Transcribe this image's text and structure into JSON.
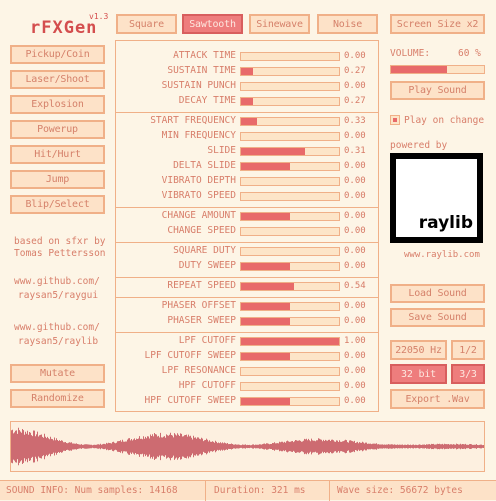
{
  "app": {
    "title": "rFXGen",
    "version": "v1.3"
  },
  "wave_tabs": [
    {
      "label": "Square",
      "active": false
    },
    {
      "label": "Sawtooth",
      "active": true
    },
    {
      "label": "Sinewave",
      "active": false
    },
    {
      "label": "Noise",
      "active": false
    }
  ],
  "screen_size_label": "Screen Size x2",
  "presets": [
    "Pickup/Coin",
    "Laser/Shoot",
    "Explosion",
    "Powerup",
    "Hit/Hurt",
    "Jump",
    "Blip/Select"
  ],
  "credits": {
    "line1": "based on sfxr by",
    "line2": "Tomas Pettersson",
    "repo1a": "www.github.com/",
    "repo1b": "raysan5/raygui",
    "repo2a": "www.github.com/",
    "repo2b": "raysan5/raylib"
  },
  "mutate_label": "Mutate",
  "randomize_label": "Randomize",
  "groups": [
    {
      "params": [
        {
          "label": "ATTACK TIME",
          "value": "0.00",
          "fill": 0.0
        },
        {
          "label": "SUSTAIN TIME",
          "value": "0.27",
          "fill": 0.12
        },
        {
          "label": "SUSTAIN PUNCH",
          "value": "0.00",
          "fill": 0.0
        },
        {
          "label": "DECAY TIME",
          "value": "0.27",
          "fill": 0.12
        }
      ]
    },
    {
      "params": [
        {
          "label": "START FREQUENCY",
          "value": "0.33",
          "fill": 0.16
        },
        {
          "label": "MIN FREQUENCY",
          "value": "0.00",
          "fill": 0.0
        },
        {
          "label": "SLIDE",
          "value": "0.31",
          "fill": 0.65
        },
        {
          "label": "DELTA SLIDE",
          "value": "0.00",
          "fill": 0.5
        },
        {
          "label": "VIBRATO DEPTH",
          "value": "0.00",
          "fill": 0.0
        },
        {
          "label": "VIBRATO SPEED",
          "value": "0.00",
          "fill": 0.0
        }
      ]
    },
    {
      "params": [
        {
          "label": "CHANGE AMOUNT",
          "value": "0.00",
          "fill": 0.5
        },
        {
          "label": "CHANGE SPEED",
          "value": "0.00",
          "fill": 0.0
        }
      ]
    },
    {
      "params": [
        {
          "label": "SQUARE DUTY",
          "value": "0.00",
          "fill": 0.0
        },
        {
          "label": "DUTY SWEEP",
          "value": "0.00",
          "fill": 0.5
        }
      ]
    },
    {
      "params": [
        {
          "label": "REPEAT SPEED",
          "value": "0.54",
          "fill": 0.54
        }
      ]
    },
    {
      "params": [
        {
          "label": "PHASER OFFSET",
          "value": "0.00",
          "fill": 0.5
        },
        {
          "label": "PHASER SWEEP",
          "value": "0.00",
          "fill": 0.5
        }
      ]
    },
    {
      "params": [
        {
          "label": "LPF CUTOFF",
          "value": "1.00",
          "fill": 1.0
        },
        {
          "label": "LPF CUTOFF SWEEP",
          "value": "0.00",
          "fill": 0.5
        },
        {
          "label": "LPF RESONANCE",
          "value": "0.00",
          "fill": 0.0
        },
        {
          "label": "HPF CUTOFF",
          "value": "0.00",
          "fill": 0.0
        },
        {
          "label": "HPF CUTOFF SWEEP",
          "value": "0.00",
          "fill": 0.5
        }
      ]
    }
  ],
  "volume": {
    "label": "VOLUME:",
    "value_text": "60 %",
    "fill": 0.6
  },
  "play_sound_label": "Play Sound",
  "play_on_change": {
    "label": "Play on change",
    "checked": true
  },
  "powered_by": "powered by",
  "raylib_logo_text": "raylib",
  "raylib_url": "www.raylib.com",
  "load_sound_label": "Load Sound",
  "save_sound_label": "Save Sound",
  "sample_rate": {
    "options": [
      "22050 Hz",
      "1/2"
    ]
  },
  "bit_depth": {
    "options": [
      "32 bit",
      "3/3"
    ]
  },
  "export_label": "Export .Wav",
  "status": {
    "samples": "SOUND INFO: Num samples: 14168",
    "duration": "Duration: 321 ms",
    "size": "Wave size: 56672 bytes"
  },
  "colors": {
    "accent": "#e86a6a",
    "border": "#f0b088",
    "bg": "#fdf5e6",
    "text": "#d77b67"
  }
}
